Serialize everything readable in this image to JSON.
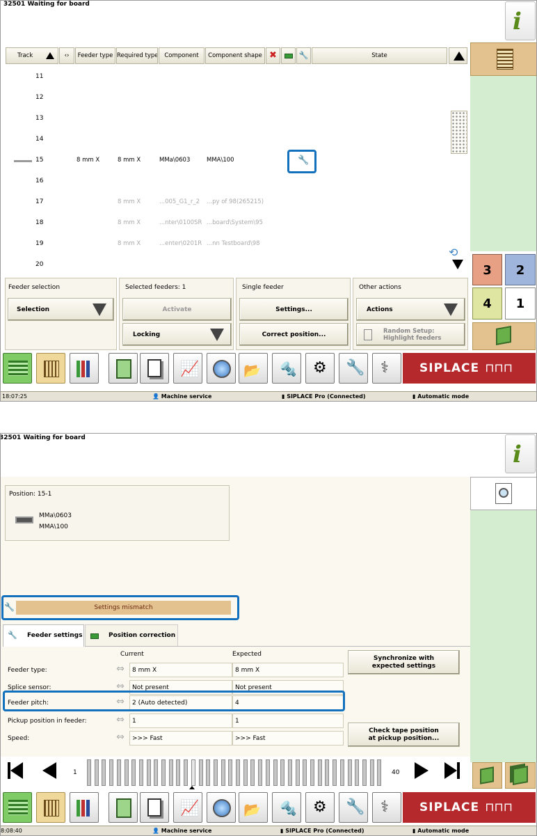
{
  "s1": {
    "title": "32501 Waiting for board",
    "headers": [
      "Track",
      "Feeder type",
      "Required type",
      "Component",
      "Component shape",
      "State"
    ],
    "rows": [
      {
        "n": "11"
      },
      {
        "n": "12"
      },
      {
        "n": "13"
      },
      {
        "n": "14"
      },
      {
        "n": "15",
        "ft": "8 mm X",
        "rt": "8 mm X",
        "comp": "MMa\\0603",
        "shape": "MMA\\100",
        "active": true
      },
      {
        "n": "16"
      },
      {
        "n": "17",
        "rt": "8 mm X",
        "comp": "...005_G1_r_2",
        "shape": "...py of 98(265215)"
      },
      {
        "n": "18",
        "rt": "8 mm X",
        "comp": "...nter\\0100SR",
        "shape": "...board\\System\\95"
      },
      {
        "n": "19",
        "rt": "8 mm X",
        "comp": "...enter\\0201R",
        "shape": "...nn Testboard\\98"
      },
      {
        "n": "20"
      }
    ],
    "feeder_selection": {
      "title": "Feeder selection",
      "selection": "Selection"
    },
    "selected_feeders": {
      "title": "Selected feeders: 1",
      "activate": "Activate",
      "locking": "Locking"
    },
    "single_feeder": {
      "title": "Single feeder",
      "settings": "Settings...",
      "correct": "Correct position..."
    },
    "other_actions": {
      "title": "Other actions",
      "actions": "Actions",
      "random": "Random Setup:",
      "highlight": "Highlight feeders"
    },
    "nums": [
      "3",
      "2",
      "4",
      "1"
    ],
    "status": {
      "time": "18:07:25",
      "service": "Machine service",
      "conn": "SIPLACE Pro (Connected)",
      "mode": "Automatic mode"
    }
  },
  "s2": {
    "title": "32501 Waiting for board",
    "position": "Position: 15-1",
    "comp": "MMa\\0603",
    "shape": "MMA\\100",
    "mismatch": "Settings mismatch",
    "tab1": "Feeder settings",
    "tab2": "Position correction",
    "col_current": "Current",
    "col_expected": "Expected",
    "rows": [
      {
        "label": "Feeder type:",
        "cur": "8 mm X",
        "exp": "8 mm X"
      },
      {
        "label": "Splice sensor:",
        "cur": "Not present",
        "exp": "Not present"
      },
      {
        "label": "Feeder pitch:",
        "cur": "2 (Auto detected)",
        "exp": "4"
      },
      {
        "label": "Pickup position in feeder:",
        "cur": "1",
        "exp": "1"
      },
      {
        "label": "Speed:",
        "cur": ">>> Fast",
        "exp": ">>> Fast"
      }
    ],
    "sync1": "Synchronize with",
    "sync2": "expected settings",
    "check1": "Check tape position",
    "check2": "at pickup position...",
    "track_start": "1",
    "track_end": "40",
    "status": {
      "time": "8:08:40",
      "service": "Machine service",
      "conn": "SIPLACE Pro (Connected)",
      "mode": "Automatic mode"
    }
  },
  "brand": "SIPLACE",
  "colors": {
    "accent": "#1270bd",
    "side_green": "#d4ecd0",
    "tan": "#e3c290",
    "logo_red": "#b5282c"
  }
}
